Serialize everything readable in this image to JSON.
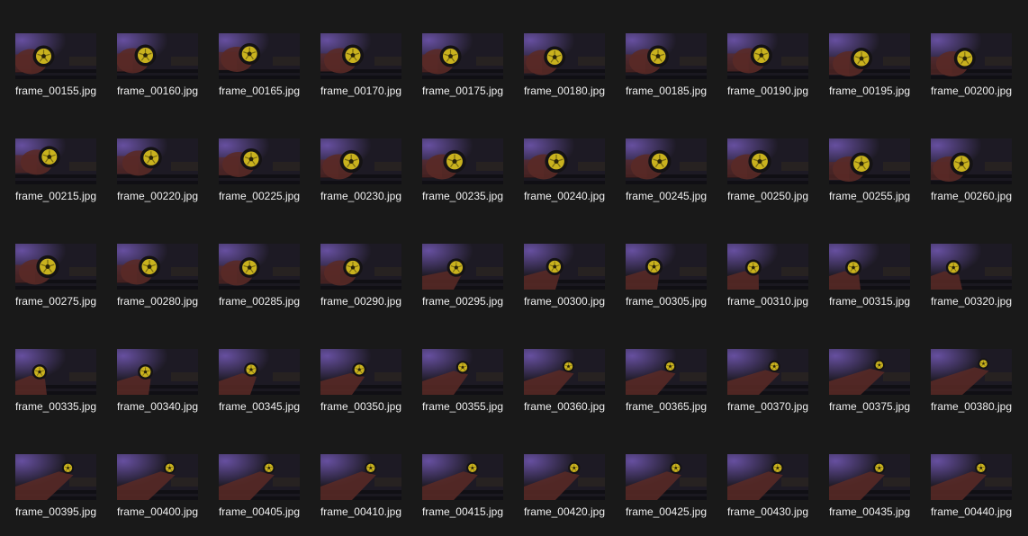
{
  "view": {
    "type": "file-explorer-thumbnail-grid",
    "background": "#191919",
    "text_color": "#f0f0f0"
  },
  "thumbnail_colors": {
    "background": "#1d1a24",
    "purple_glow": "#6a52a6",
    "hand": "#5a2a26",
    "tire": "#141214",
    "rim": "#c9b21e",
    "hub": "#2a2408"
  },
  "files": [
    {
      "name": "frame_00155.jpg",
      "wheel": [
        0.35,
        0.5
      ],
      "scale": 1.0,
      "hand": "left"
    },
    {
      "name": "frame_00160.jpg",
      "wheel": [
        0.35,
        0.48
      ],
      "scale": 1.0,
      "hand": "left"
    },
    {
      "name": "frame_00165.jpg",
      "wheel": [
        0.38,
        0.45
      ],
      "scale": 1.0,
      "hand": "left"
    },
    {
      "name": "frame_00170.jpg",
      "wheel": [
        0.4,
        0.48
      ],
      "scale": 1.0,
      "hand": "left"
    },
    {
      "name": "frame_00175.jpg",
      "wheel": [
        0.35,
        0.5
      ],
      "scale": 1.0,
      "hand": "left"
    },
    {
      "name": "frame_00180.jpg",
      "wheel": [
        0.38,
        0.52
      ],
      "scale": 1.0,
      "hand": "left"
    },
    {
      "name": "frame_00185.jpg",
      "wheel": [
        0.4,
        0.5
      ],
      "scale": 1.0,
      "hand": "left"
    },
    {
      "name": "frame_00190.jpg",
      "wheel": [
        0.42,
        0.48
      ],
      "scale": 1.0,
      "hand": "left"
    },
    {
      "name": "frame_00195.jpg",
      "wheel": [
        0.4,
        0.55
      ],
      "scale": 1.0,
      "hand": "left"
    },
    {
      "name": "frame_00200.jpg",
      "wheel": [
        0.42,
        0.55
      ],
      "scale": 1.0,
      "hand": "left"
    },
    {
      "name": "frame_00215.jpg",
      "wheel": [
        0.42,
        0.4
      ],
      "scale": 1.0,
      "hand": "left"
    },
    {
      "name": "frame_00220.jpg",
      "wheel": [
        0.42,
        0.42
      ],
      "scale": 1.0,
      "hand": "left"
    },
    {
      "name": "frame_00225.jpg",
      "wheel": [
        0.4,
        0.45
      ],
      "scale": 1.0,
      "hand": "left"
    },
    {
      "name": "frame_00230.jpg",
      "wheel": [
        0.38,
        0.5
      ],
      "scale": 1.05,
      "hand": "left"
    },
    {
      "name": "frame_00235.jpg",
      "wheel": [
        0.4,
        0.5
      ],
      "scale": 1.05,
      "hand": "left"
    },
    {
      "name": "frame_00240.jpg",
      "wheel": [
        0.4,
        0.5
      ],
      "scale": 1.05,
      "hand": "left"
    },
    {
      "name": "frame_00245.jpg",
      "wheel": [
        0.42,
        0.5
      ],
      "scale": 1.05,
      "hand": "left"
    },
    {
      "name": "frame_00250.jpg",
      "wheel": [
        0.4,
        0.5
      ],
      "scale": 1.05,
      "hand": "left"
    },
    {
      "name": "frame_00255.jpg",
      "wheel": [
        0.4,
        0.55
      ],
      "scale": 1.05,
      "hand": "left"
    },
    {
      "name": "frame_00260.jpg",
      "wheel": [
        0.38,
        0.55
      ],
      "scale": 1.05,
      "hand": "left"
    },
    {
      "name": "frame_00275.jpg",
      "wheel": [
        0.4,
        0.5
      ],
      "scale": 1.05,
      "hand": "left"
    },
    {
      "name": "frame_00280.jpg",
      "wheel": [
        0.4,
        0.5
      ],
      "scale": 1.0,
      "hand": "left"
    },
    {
      "name": "frame_00285.jpg",
      "wheel": [
        0.38,
        0.52
      ],
      "scale": 0.95,
      "hand": "left"
    },
    {
      "name": "frame_00290.jpg",
      "wheel": [
        0.4,
        0.52
      ],
      "scale": 0.9,
      "hand": "left"
    },
    {
      "name": "frame_00295.jpg",
      "wheel": [
        0.42,
        0.52
      ],
      "scale": 0.85,
      "hand": "bottom"
    },
    {
      "name": "frame_00300.jpg",
      "wheel": [
        0.38,
        0.5
      ],
      "scale": 0.8,
      "hand": "bottom"
    },
    {
      "name": "frame_00305.jpg",
      "wheel": [
        0.35,
        0.5
      ],
      "scale": 0.8,
      "hand": "bottom"
    },
    {
      "name": "frame_00310.jpg",
      "wheel": [
        0.32,
        0.52
      ],
      "scale": 0.75,
      "hand": "bottom"
    },
    {
      "name": "frame_00315.jpg",
      "wheel": [
        0.3,
        0.52
      ],
      "scale": 0.75,
      "hand": "bottom"
    },
    {
      "name": "frame_00320.jpg",
      "wheel": [
        0.28,
        0.52
      ],
      "scale": 0.7,
      "hand": "bottom"
    },
    {
      "name": "frame_00335.jpg",
      "wheel": [
        0.3,
        0.5
      ],
      "scale": 0.7,
      "hand": "bottom"
    },
    {
      "name": "frame_00340.jpg",
      "wheel": [
        0.35,
        0.5
      ],
      "scale": 0.7,
      "hand": "bottom"
    },
    {
      "name": "frame_00345.jpg",
      "wheel": [
        0.4,
        0.45
      ],
      "scale": 0.65,
      "hand": "bottom"
    },
    {
      "name": "frame_00350.jpg",
      "wheel": [
        0.48,
        0.45
      ],
      "scale": 0.65,
      "hand": "bottom"
    },
    {
      "name": "frame_00355.jpg",
      "wheel": [
        0.5,
        0.4
      ],
      "scale": 0.6,
      "hand": "bottom"
    },
    {
      "name": "frame_00360.jpg",
      "wheel": [
        0.55,
        0.38
      ],
      "scale": 0.55,
      "hand": "bottom"
    },
    {
      "name": "frame_00365.jpg",
      "wheel": [
        0.55,
        0.38
      ],
      "scale": 0.55,
      "hand": "bottom"
    },
    {
      "name": "frame_00370.jpg",
      "wheel": [
        0.58,
        0.38
      ],
      "scale": 0.55,
      "hand": "bottom"
    },
    {
      "name": "frame_00375.jpg",
      "wheel": [
        0.62,
        0.35
      ],
      "scale": 0.5,
      "hand": "bottom"
    },
    {
      "name": "frame_00380.jpg",
      "wheel": [
        0.65,
        0.32
      ],
      "scale": 0.5,
      "hand": "bottom"
    },
    {
      "name": "frame_00395.jpg",
      "wheel": [
        0.65,
        0.3
      ],
      "scale": 0.55,
      "hand": "bottom"
    },
    {
      "name": "frame_00400.jpg",
      "wheel": [
        0.65,
        0.3
      ],
      "scale": 0.55,
      "hand": "bottom"
    },
    {
      "name": "frame_00405.jpg",
      "wheel": [
        0.62,
        0.3
      ],
      "scale": 0.55,
      "hand": "bottom"
    },
    {
      "name": "frame_00410.jpg",
      "wheel": [
        0.62,
        0.3
      ],
      "scale": 0.55,
      "hand": "bottom"
    },
    {
      "name": "frame_00415.jpg",
      "wheel": [
        0.62,
        0.3
      ],
      "scale": 0.55,
      "hand": "bottom"
    },
    {
      "name": "frame_00420.jpg",
      "wheel": [
        0.62,
        0.3
      ],
      "scale": 0.55,
      "hand": "bottom"
    },
    {
      "name": "frame_00425.jpg",
      "wheel": [
        0.62,
        0.3
      ],
      "scale": 0.55,
      "hand": "bottom"
    },
    {
      "name": "frame_00430.jpg",
      "wheel": [
        0.62,
        0.3
      ],
      "scale": 0.55,
      "hand": "bottom"
    },
    {
      "name": "frame_00435.jpg",
      "wheel": [
        0.62,
        0.3
      ],
      "scale": 0.55,
      "hand": "bottom"
    },
    {
      "name": "frame_00440.jpg",
      "wheel": [
        0.62,
        0.3
      ],
      "scale": 0.55,
      "hand": "bottom"
    }
  ]
}
